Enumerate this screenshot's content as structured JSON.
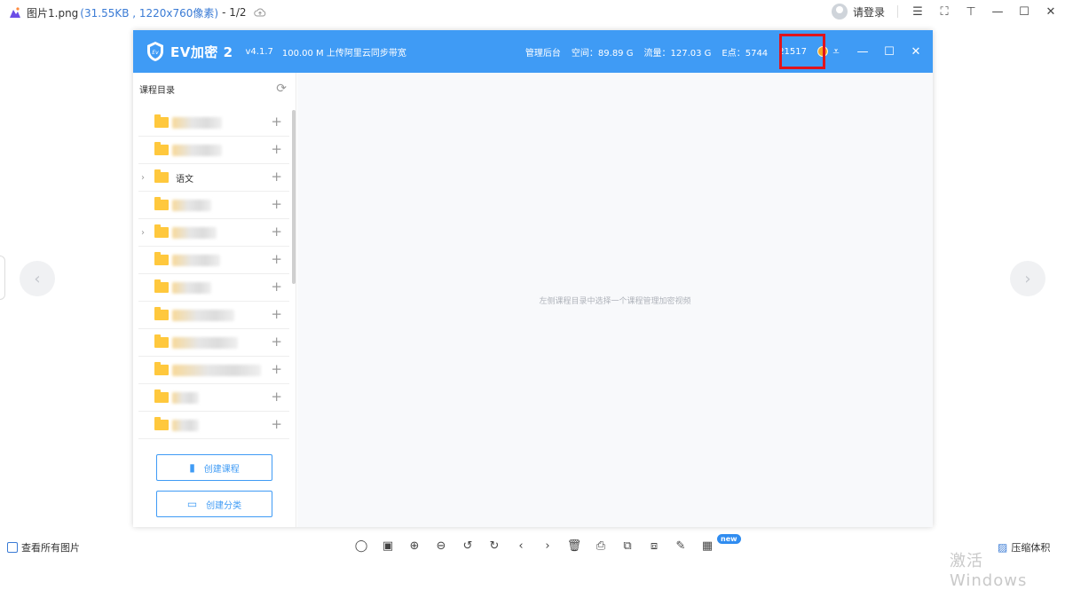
{
  "viewer": {
    "file_name": "图片1.png",
    "file_meta": "(31.55KB , 1220x760像素)",
    "index": "- 1/2",
    "login_label": "请登录"
  },
  "app": {
    "brand": "EV加密 2",
    "version": "v4.1.7",
    "bandwidth": "100.00 M 上传阿里云同步带宽",
    "stats": {
      "admin": "管理后台",
      "space": "空间：89.89 G",
      "traffic": "流量：127.03 G",
      "epoints": "E点：5744",
      "number": "21517"
    },
    "colors": {
      "titlebar": "#3f9bf5",
      "highlight": "#e0141c",
      "folder": "#ffc83d"
    }
  },
  "sidebar": {
    "title": "课程目录",
    "named_folder": "语文",
    "create_course": "创建课程",
    "create_category": "创建分类"
  },
  "main": {
    "placeholder": "左侧课程目录中选择一个课程管理加密视频"
  },
  "bottom": {
    "all_pictures": "查看所有图片",
    "compress": "压缩体积",
    "new_badge": "new",
    "watermark": "激活 Windows"
  }
}
